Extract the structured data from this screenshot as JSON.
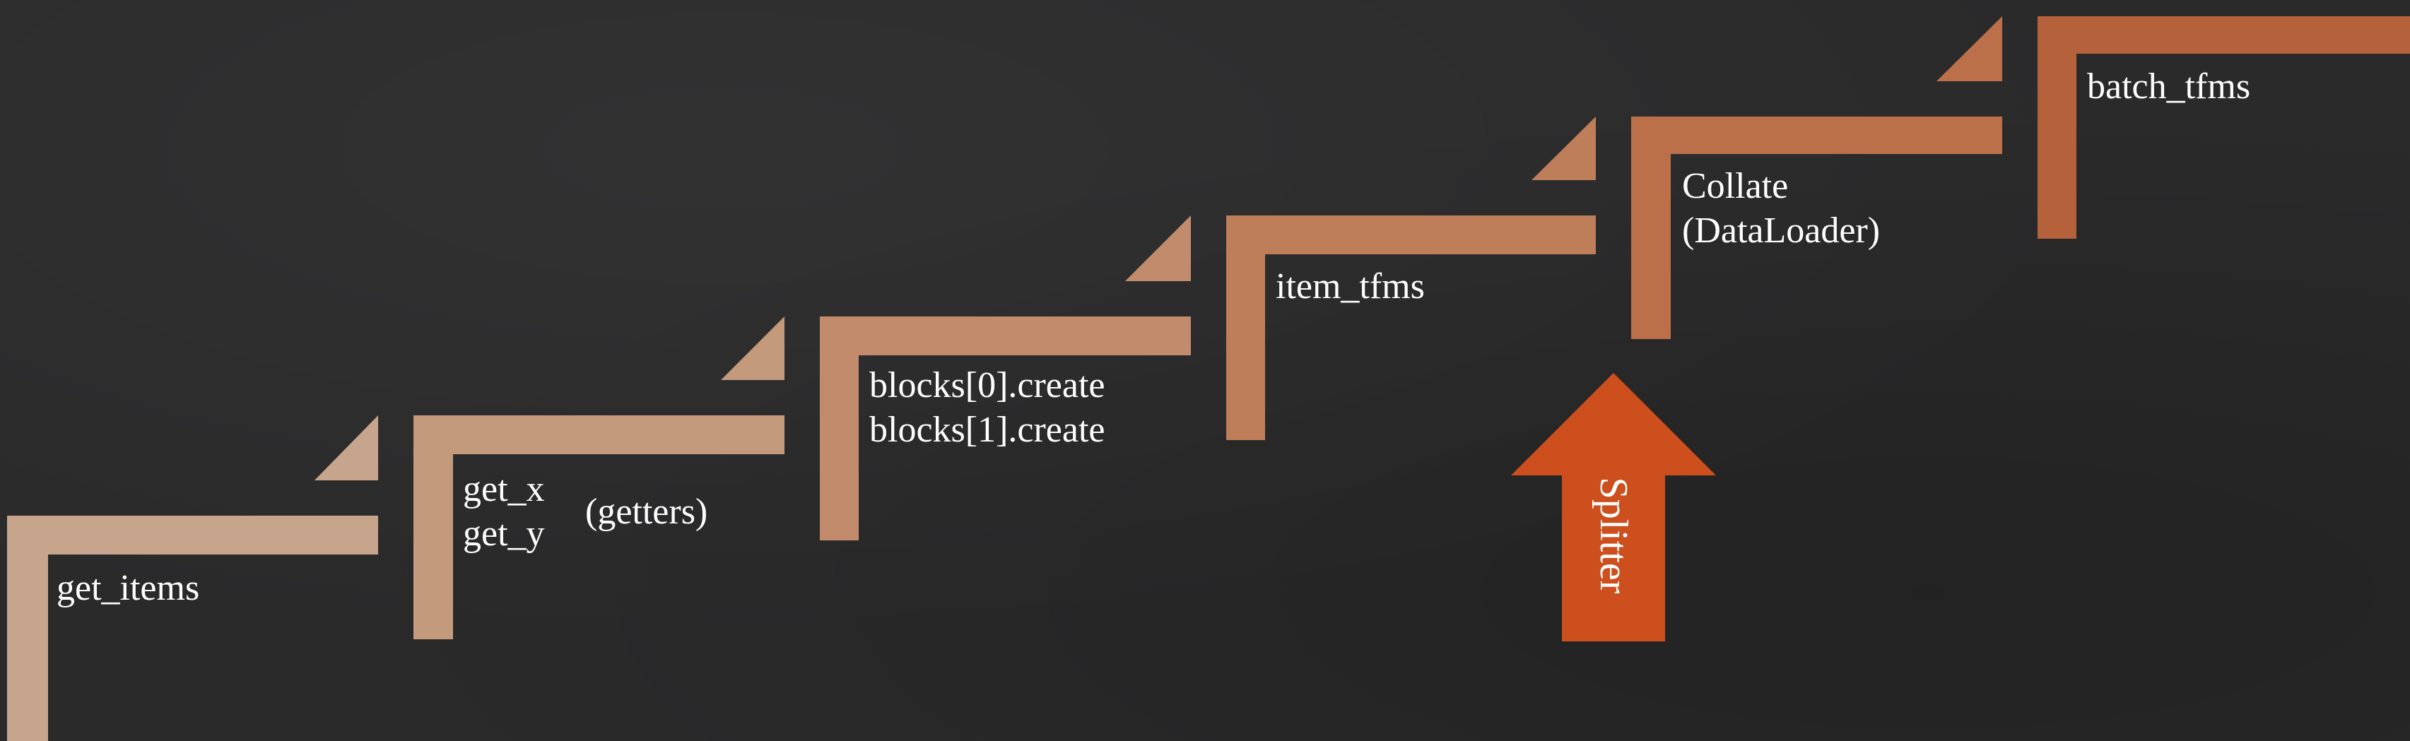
{
  "steps": [
    {
      "id": "get-items",
      "lines": [
        "get_items"
      ],
      "color": "#c7a58c"
    },
    {
      "id": "getters",
      "lines": [
        "get_x",
        "get_y"
      ],
      "side_note": "(getters)",
      "color": "#c49a7c"
    },
    {
      "id": "blocks-create",
      "lines": [
        "blocks[0].create",
        "blocks[1].create"
      ],
      "color": "#c28c6c"
    },
    {
      "id": "item-tfms",
      "lines": [
        "item_tfms"
      ],
      "color": "#bf7e5a"
    },
    {
      "id": "collate",
      "lines": [
        "Collate",
        "(DataLoader)"
      ],
      "color": "#bb7049"
    },
    {
      "id": "batch-tfms",
      "lines": [
        "batch_tfms"
      ],
      "color": "#b5613b"
    }
  ],
  "splitter": {
    "label": "Splitter",
    "color": "#cc4f1d"
  },
  "colors": {
    "background": "#2a2a2b",
    "text": "#ffffff"
  }
}
